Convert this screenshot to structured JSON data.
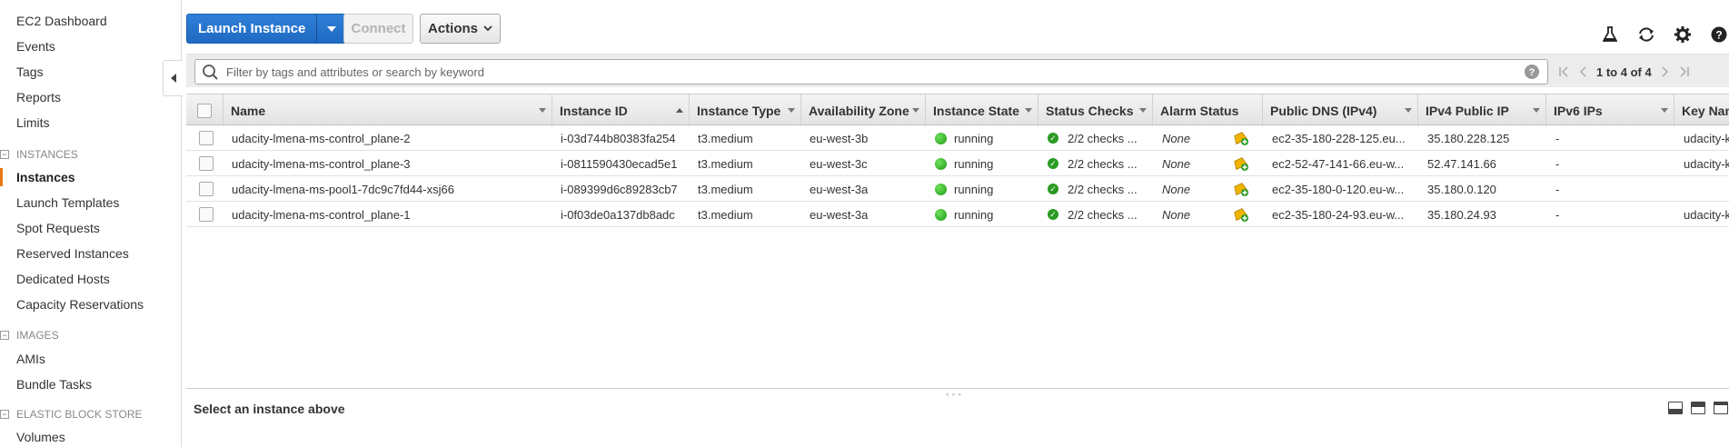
{
  "sidebar": {
    "top_items": [
      {
        "label": "EC2 Dashboard"
      },
      {
        "label": "Events"
      },
      {
        "label": "Tags"
      },
      {
        "label": "Reports"
      },
      {
        "label": "Limits"
      }
    ],
    "sections": [
      {
        "title": "INSTANCES",
        "items": [
          {
            "label": "Instances",
            "active": true
          },
          {
            "label": "Launch Templates"
          },
          {
            "label": "Spot Requests"
          },
          {
            "label": "Reserved Instances"
          },
          {
            "label": "Dedicated Hosts"
          },
          {
            "label": "Capacity Reservations"
          }
        ]
      },
      {
        "title": "IMAGES",
        "items": [
          {
            "label": "AMIs"
          },
          {
            "label": "Bundle Tasks"
          }
        ]
      },
      {
        "title": "ELASTIC BLOCK STORE",
        "items": [
          {
            "label": "Volumes"
          }
        ]
      }
    ],
    "accent_color": "#e47911"
  },
  "toolbar": {
    "launch_label": "Launch Instance",
    "connect_label": "Connect",
    "actions_label": "Actions",
    "icons": [
      "flask-icon",
      "refresh-icon",
      "gear-icon",
      "help-icon"
    ]
  },
  "search": {
    "placeholder": "Filter by tags and attributes or search by keyword",
    "value": ""
  },
  "pager": {
    "text": "1 to 4 of 4"
  },
  "table": {
    "columns": [
      {
        "label": "Name"
      },
      {
        "label": "Instance ID",
        "sorted": "asc"
      },
      {
        "label": "Instance Type"
      },
      {
        "label": "Availability Zone"
      },
      {
        "label": "Instance State"
      },
      {
        "label": "Status Checks"
      },
      {
        "label": "Alarm Status"
      },
      {
        "label": "Public DNS (IPv4)"
      },
      {
        "label": "IPv4 Public IP"
      },
      {
        "label": "IPv6 IPs"
      },
      {
        "label": "Key Nan"
      }
    ],
    "rows": [
      {
        "name": "udacity-lmena-ms-control_plane-2",
        "instance_id": "i-03d744b80383fa254",
        "type": "t3.medium",
        "zone": "eu-west-3b",
        "state": "running",
        "status_checks": "2/2 checks ...",
        "alarm": "None",
        "dns": "ec2-35-180-228-125.eu...",
        "ip": "35.180.228.125",
        "ipv6": "-",
        "key": "udacity-k"
      },
      {
        "name": "udacity-lmena-ms-control_plane-3",
        "instance_id": "i-0811590430ecad5e1",
        "type": "t3.medium",
        "zone": "eu-west-3c",
        "state": "running",
        "status_checks": "2/2 checks ...",
        "alarm": "None",
        "dns": "ec2-52-47-141-66.eu-w...",
        "ip": "52.47.141.66",
        "ipv6": "-",
        "key": "udacity-k"
      },
      {
        "name": "udacity-lmena-ms-pool1-7dc9c7fd44-xsj66",
        "instance_id": "i-089399d6c89283cb7",
        "type": "t3.medium",
        "zone": "eu-west-3a",
        "state": "running",
        "status_checks": "2/2 checks ...",
        "alarm": "None",
        "dns": "ec2-35-180-0-120.eu-w...",
        "ip": "35.180.0.120",
        "ipv6": "-",
        "key": ""
      },
      {
        "name": "udacity-lmena-ms-control_plane-1",
        "instance_id": "i-0f03de0a137db8adc",
        "type": "t3.medium",
        "zone": "eu-west-3a",
        "state": "running",
        "status_checks": "2/2 checks ...",
        "alarm": "None",
        "dns": "ec2-35-180-24-93.eu-w...",
        "ip": "35.180.24.93",
        "ipv6": "-",
        "key": "udacity-k"
      }
    ],
    "state_color": "#2a9a22"
  },
  "details": {
    "title": "Select an instance above",
    "grip": "∘∘∘"
  }
}
